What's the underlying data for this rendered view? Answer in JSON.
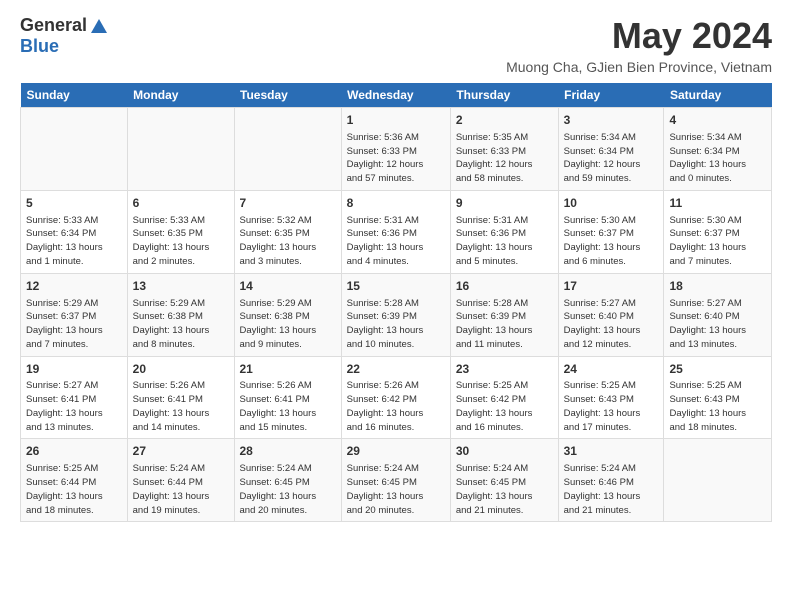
{
  "header": {
    "logo_general": "General",
    "logo_blue": "Blue",
    "month_year": "May 2024",
    "location": "Muong Cha, GJien Bien Province, Vietnam"
  },
  "days_of_week": [
    "Sunday",
    "Monday",
    "Tuesday",
    "Wednesday",
    "Thursday",
    "Friday",
    "Saturday"
  ],
  "weeks": [
    {
      "days": [
        {
          "num": "",
          "info": ""
        },
        {
          "num": "",
          "info": ""
        },
        {
          "num": "",
          "info": ""
        },
        {
          "num": "1",
          "info": "Sunrise: 5:36 AM\nSunset: 6:33 PM\nDaylight: 12 hours\nand 57 minutes."
        },
        {
          "num": "2",
          "info": "Sunrise: 5:35 AM\nSunset: 6:33 PM\nDaylight: 12 hours\nand 58 minutes."
        },
        {
          "num": "3",
          "info": "Sunrise: 5:34 AM\nSunset: 6:34 PM\nDaylight: 12 hours\nand 59 minutes."
        },
        {
          "num": "4",
          "info": "Sunrise: 5:34 AM\nSunset: 6:34 PM\nDaylight: 13 hours\nand 0 minutes."
        }
      ]
    },
    {
      "days": [
        {
          "num": "5",
          "info": "Sunrise: 5:33 AM\nSunset: 6:34 PM\nDaylight: 13 hours\nand 1 minute."
        },
        {
          "num": "6",
          "info": "Sunrise: 5:33 AM\nSunset: 6:35 PM\nDaylight: 13 hours\nand 2 minutes."
        },
        {
          "num": "7",
          "info": "Sunrise: 5:32 AM\nSunset: 6:35 PM\nDaylight: 13 hours\nand 3 minutes."
        },
        {
          "num": "8",
          "info": "Sunrise: 5:31 AM\nSunset: 6:36 PM\nDaylight: 13 hours\nand 4 minutes."
        },
        {
          "num": "9",
          "info": "Sunrise: 5:31 AM\nSunset: 6:36 PM\nDaylight: 13 hours\nand 5 minutes."
        },
        {
          "num": "10",
          "info": "Sunrise: 5:30 AM\nSunset: 6:37 PM\nDaylight: 13 hours\nand 6 minutes."
        },
        {
          "num": "11",
          "info": "Sunrise: 5:30 AM\nSunset: 6:37 PM\nDaylight: 13 hours\nand 7 minutes."
        }
      ]
    },
    {
      "days": [
        {
          "num": "12",
          "info": "Sunrise: 5:29 AM\nSunset: 6:37 PM\nDaylight: 13 hours\nand 7 minutes."
        },
        {
          "num": "13",
          "info": "Sunrise: 5:29 AM\nSunset: 6:38 PM\nDaylight: 13 hours\nand 8 minutes."
        },
        {
          "num": "14",
          "info": "Sunrise: 5:29 AM\nSunset: 6:38 PM\nDaylight: 13 hours\nand 9 minutes."
        },
        {
          "num": "15",
          "info": "Sunrise: 5:28 AM\nSunset: 6:39 PM\nDaylight: 13 hours\nand 10 minutes."
        },
        {
          "num": "16",
          "info": "Sunrise: 5:28 AM\nSunset: 6:39 PM\nDaylight: 13 hours\nand 11 minutes."
        },
        {
          "num": "17",
          "info": "Sunrise: 5:27 AM\nSunset: 6:40 PM\nDaylight: 13 hours\nand 12 minutes."
        },
        {
          "num": "18",
          "info": "Sunrise: 5:27 AM\nSunset: 6:40 PM\nDaylight: 13 hours\nand 13 minutes."
        }
      ]
    },
    {
      "days": [
        {
          "num": "19",
          "info": "Sunrise: 5:27 AM\nSunset: 6:41 PM\nDaylight: 13 hours\nand 13 minutes."
        },
        {
          "num": "20",
          "info": "Sunrise: 5:26 AM\nSunset: 6:41 PM\nDaylight: 13 hours\nand 14 minutes."
        },
        {
          "num": "21",
          "info": "Sunrise: 5:26 AM\nSunset: 6:41 PM\nDaylight: 13 hours\nand 15 minutes."
        },
        {
          "num": "22",
          "info": "Sunrise: 5:26 AM\nSunset: 6:42 PM\nDaylight: 13 hours\nand 16 minutes."
        },
        {
          "num": "23",
          "info": "Sunrise: 5:25 AM\nSunset: 6:42 PM\nDaylight: 13 hours\nand 16 minutes."
        },
        {
          "num": "24",
          "info": "Sunrise: 5:25 AM\nSunset: 6:43 PM\nDaylight: 13 hours\nand 17 minutes."
        },
        {
          "num": "25",
          "info": "Sunrise: 5:25 AM\nSunset: 6:43 PM\nDaylight: 13 hours\nand 18 minutes."
        }
      ]
    },
    {
      "days": [
        {
          "num": "26",
          "info": "Sunrise: 5:25 AM\nSunset: 6:44 PM\nDaylight: 13 hours\nand 18 minutes."
        },
        {
          "num": "27",
          "info": "Sunrise: 5:24 AM\nSunset: 6:44 PM\nDaylight: 13 hours\nand 19 minutes."
        },
        {
          "num": "28",
          "info": "Sunrise: 5:24 AM\nSunset: 6:45 PM\nDaylight: 13 hours\nand 20 minutes."
        },
        {
          "num": "29",
          "info": "Sunrise: 5:24 AM\nSunset: 6:45 PM\nDaylight: 13 hours\nand 20 minutes."
        },
        {
          "num": "30",
          "info": "Sunrise: 5:24 AM\nSunset: 6:45 PM\nDaylight: 13 hours\nand 21 minutes."
        },
        {
          "num": "31",
          "info": "Sunrise: 5:24 AM\nSunset: 6:46 PM\nDaylight: 13 hours\nand 21 minutes."
        },
        {
          "num": "",
          "info": ""
        }
      ]
    }
  ]
}
